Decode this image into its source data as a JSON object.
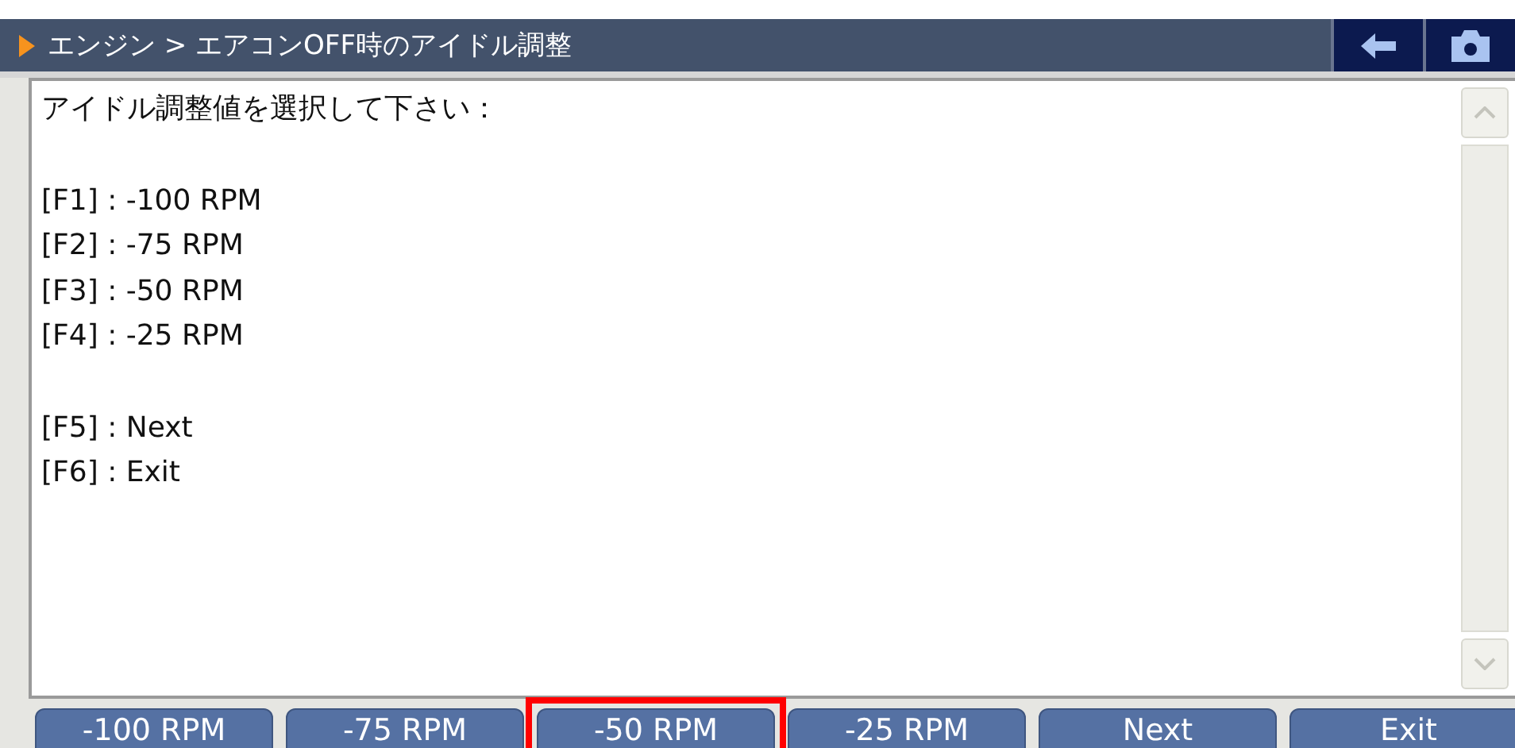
{
  "title_bar": {
    "breadcrumb": "エンジン > エアコンOFF時のアイドル調整"
  },
  "content": {
    "paragraphs": [
      [
        "アイドル調整値を選択して下さい："
      ],
      [
        "[F1] : -100 RPM",
        "[F2] : -75 RPM",
        "[F3] : -50 RPM",
        "[F4] : -25 RPM"
      ],
      [
        "[F5] : Next",
        "[F6] : Exit"
      ]
    ]
  },
  "buttons": [
    {
      "label": "-100 RPM",
      "highlighted": false
    },
    {
      "label": "-75 RPM",
      "highlighted": false
    },
    {
      "label": "-50 RPM",
      "highlighted": true
    },
    {
      "label": "-25 RPM",
      "highlighted": false
    },
    {
      "label": "Next",
      "highlighted": false
    },
    {
      "label": "Exit",
      "highlighted": false
    }
  ]
}
